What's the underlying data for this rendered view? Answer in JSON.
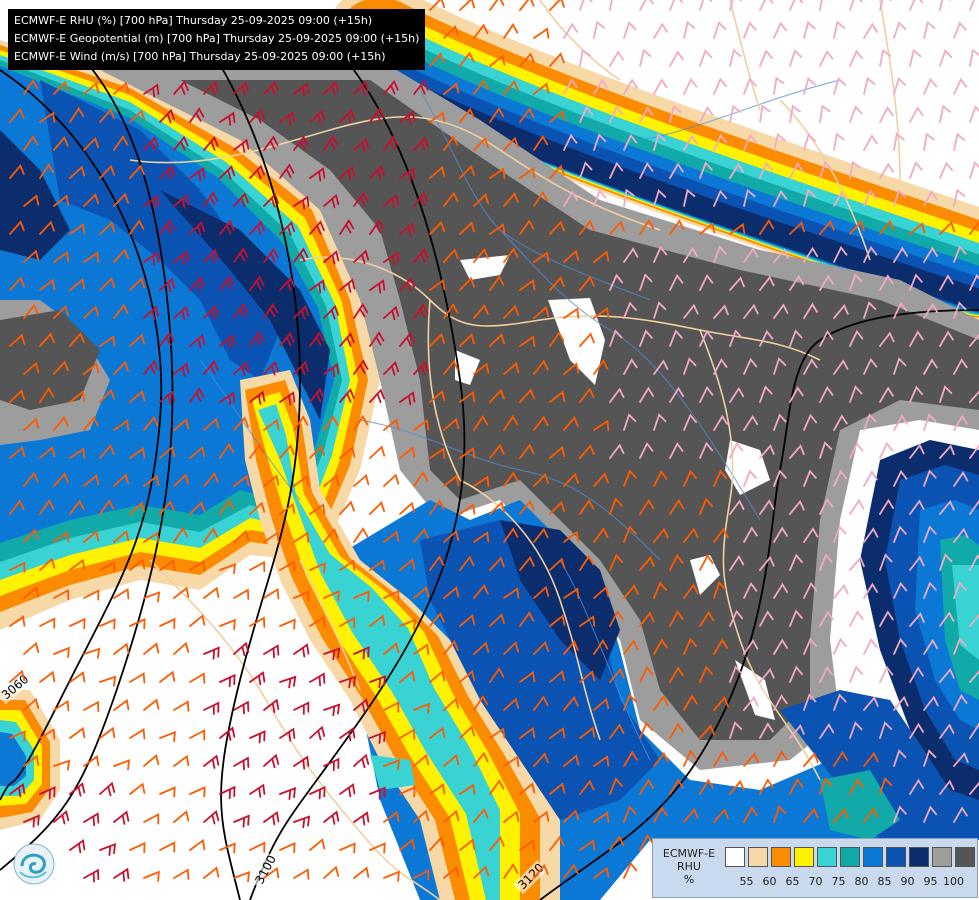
{
  "title_lines": [
    "ECMWF-E RHU (%) [700 hPa] Thursday 25-09-2025 09:00 (+15h)",
    "ECMWF-E Geopotential (m) [700 hPa] Thursday 25-09-2025 09:00 (+15h)",
    "ECMWF-E Wind (m/s) [700 hPa] Thursday 25-09-2025 09:00 (+15h)"
  ],
  "contour_labels": [
    "3060",
    "3100",
    "3120"
  ],
  "legend": {
    "title_lines": [
      "ECMWF-E",
      "RHU",
      "%"
    ],
    "levels": [
      "50",
      "55",
      "60",
      "65",
      "70",
      "75",
      "80",
      "85",
      "90",
      "95",
      "100"
    ],
    "colors": [
      "#ffffff",
      "#f7d9a8",
      "#fb8b00",
      "#fff200",
      "#39d3d3",
      "#12aaa8",
      "#0b78d6",
      "#0a53b3",
      "#0b2d6e",
      "#9d9d9d",
      "#555555"
    ]
  },
  "colors": {
    "background": "#ffffff",
    "contour": "#000000",
    "borders": "#f0d0a0",
    "rivers": "#4f8ed8",
    "barb_red": "#c8102e",
    "barb_orange": "#ff5a00",
    "barb_pink": "#f2a9c4"
  },
  "icons": [
    "ecmwf-logo-icon"
  ]
}
